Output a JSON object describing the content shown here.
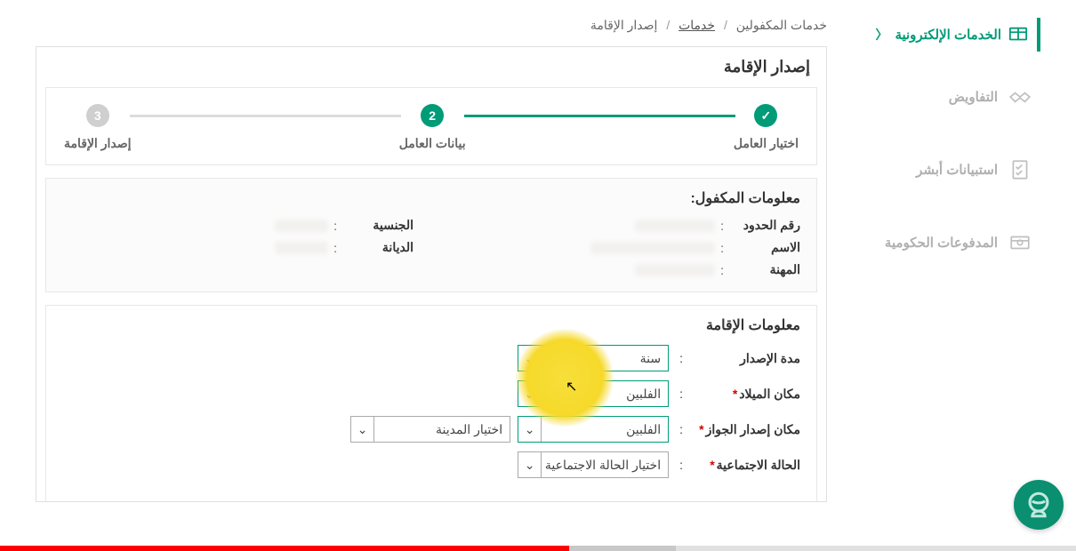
{
  "breadcrumb": {
    "root": "خدمات المكفولين",
    "link": "خدمات",
    "current": "إصدار الإقامة"
  },
  "sidebar": {
    "active": "الخدمات الإلكترونية",
    "items": [
      "التفاويض",
      "استبيانات أبشر",
      "المدفوعات الحكومية"
    ]
  },
  "page_title": "إصدار الإقامة",
  "steps": {
    "s1": "اختيار العامل",
    "s2_num": "2",
    "s2": "بيانات العامل",
    "s3_num": "3",
    "s3": "إصدار الإقامة"
  },
  "sponsor_panel": {
    "title": "معلومات المكفول:",
    "fields": {
      "border_no": "رقم الحدود",
      "nationality": "الجنسية",
      "name": "الاسم",
      "religion": "الديانة",
      "profession": "المهنة"
    }
  },
  "iqama_panel": {
    "title": "معلومات الإقامة",
    "rows": {
      "issue_period": "مدة الإصدار",
      "birth_place": "مكان الميلاد",
      "passport_place": "مكان إصدار الجواز",
      "marital": "الحالة الاجتماعية"
    },
    "values": {
      "issue_period": "سنة",
      "birth_place": "الفلبين",
      "passport_place": "الفلبين",
      "city_placeholder": "اختيار المدينة",
      "marital_placeholder": "اختيار الحالة الاجتماعية"
    }
  }
}
